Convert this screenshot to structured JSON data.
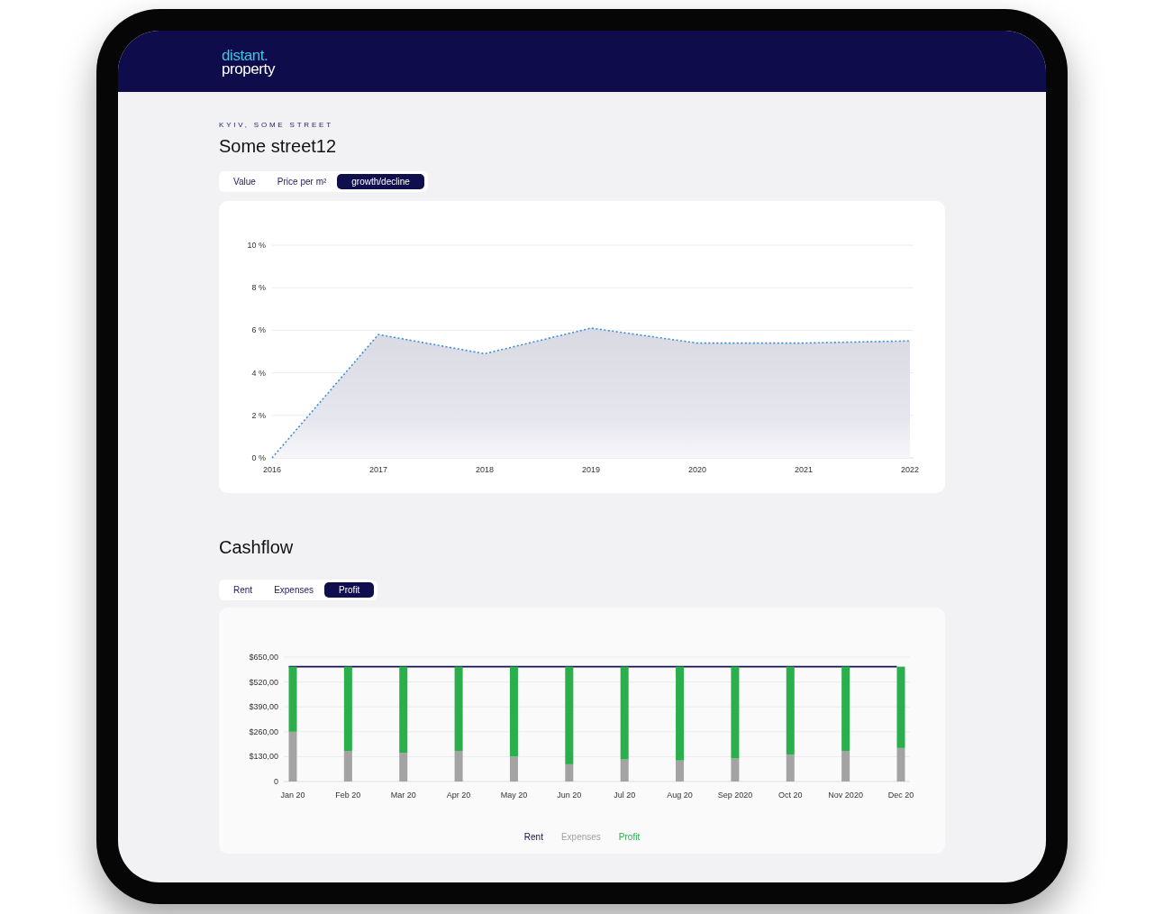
{
  "header": {
    "logo_top": "distant.",
    "logo_bottom": "property"
  },
  "property": {
    "location": "KYIV, SOME STREET",
    "title": "Some street12"
  },
  "value_chart": {
    "tabs": [
      {
        "label": "Value",
        "selected": false
      },
      {
        "label": "Price per m²",
        "selected": false
      },
      {
        "label": "growth/decline",
        "selected": true
      }
    ],
    "chart_data": {
      "type": "area",
      "grid": true,
      "categories": [
        "2016",
        "2017",
        "2018",
        "2019",
        "2020",
        "2021",
        "2022"
      ],
      "values": [
        0,
        5.8,
        4.9,
        6.1,
        5.4,
        5.4,
        5.5
      ],
      "ylim": [
        0,
        10
      ],
      "yticks": [
        {
          "value": 0,
          "label": "0 %"
        },
        {
          "value": 2,
          "label": "2 %"
        },
        {
          "value": 4,
          "label": "4 %"
        },
        {
          "value": 6,
          "label": "6 %"
        },
        {
          "value": 8,
          "label": "8 %"
        },
        {
          "value": 10,
          "label": "10 %"
        }
      ]
    }
  },
  "cashflow": {
    "title": "Cashflow",
    "tabs": [
      {
        "label": "Rent",
        "selected": false
      },
      {
        "label": "Expenses",
        "selected": false
      },
      {
        "label": "Profit",
        "selected": true
      }
    ],
    "chart_data": {
      "type": "bar",
      "stacked": true,
      "grid": true,
      "categories": [
        "Jan 20",
        "Feb 20",
        "Mar 20",
        "Apr 20",
        "May 20",
        "Jun 20",
        "Jul 20",
        "Aug 20",
        "Sep 2020",
        "Oct 20",
        "Nov 2020",
        "Dec 20"
      ],
      "ylim": [
        0,
        650
      ],
      "yticks": [
        {
          "value": 0,
          "label": "0"
        },
        {
          "value": 130,
          "label": "$130,00"
        },
        {
          "value": 260,
          "label": "$260,00"
        },
        {
          "value": 390,
          "label": "$390,00"
        },
        {
          "value": 520,
          "label": "$520,00"
        },
        {
          "value": 650,
          "label": "$650,00"
        }
      ],
      "series": [
        {
          "name": "Rent",
          "type": "line",
          "color": "#15134f",
          "values": [
            600,
            600,
            600,
            600,
            600,
            600,
            600,
            600,
            600,
            600,
            600,
            600
          ]
        },
        {
          "name": "Expenses",
          "color": "#a3a3a3",
          "values": [
            260,
            160,
            150,
            160,
            130,
            90,
            115,
            110,
            120,
            140,
            160,
            175
          ]
        },
        {
          "name": "Profit",
          "color": "#2aaf4c",
          "values": [
            340,
            440,
            450,
            440,
            470,
            510,
            485,
            490,
            480,
            460,
            440,
            425
          ]
        }
      ]
    }
  }
}
